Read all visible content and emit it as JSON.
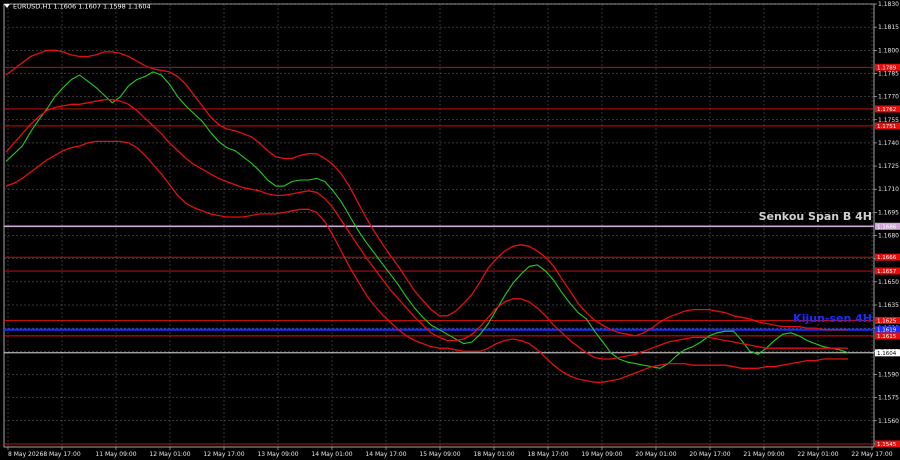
{
  "chart_data": {
    "type": "line",
    "title": "EURUSD,H1  1.1606 1.1607 1.1598 1.1604",
    "symbol_header": {
      "symbol": "EURUSD,H1",
      "open": "1.1606",
      "high": "1.1607",
      "low": "1.1598",
      "close": "1.1604"
    },
    "ylim": [
      1.1543,
      1.183
    ],
    "y_ticks": [
      "1.1830",
      "1.1815",
      "1.1800",
      "1.1785",
      "1.1770",
      "1.1755",
      "1.1740",
      "1.1725",
      "1.1710",
      "1.1695",
      "1.1680",
      "1.1665",
      "1.1650",
      "1.1635",
      "1.1620",
      "1.1605",
      "1.1590",
      "1.1575",
      "1.1560",
      "1.1545"
    ],
    "x_ticks": [
      "8 May 2026",
      "8 May 17:00",
      "11 May 09:00",
      "12 May 01:00",
      "12 May 17:00",
      "13 May 09:00",
      "14 May 01:00",
      "14 May 17:00",
      "15 May 09:00",
      "18 May 01:00",
      "18 May 17:00",
      "19 May 09:00",
      "20 May 01:00",
      "20 May 17:00",
      "21 May 09:00",
      "22 May 01:00",
      "22 May 17:00"
    ],
    "grid": true,
    "levels": [
      {
        "price": 1.1789,
        "label": "1.1789",
        "color": "#e01010"
      },
      {
        "price": 1.1762,
        "label": "1.1762",
        "color": "#e01010"
      },
      {
        "price": 1.1751,
        "label": "1.1751",
        "color": "#e01010"
      },
      {
        "price": 1.1686,
        "label": "1.1686",
        "color": "#d0a8d8"
      },
      {
        "price": 1.1666,
        "label": "1.1666",
        "color": "#e01010"
      },
      {
        "price": 1.1657,
        "label": "1.1657",
        "color": "#e01010"
      },
      {
        "price": 1.1625,
        "label": "1.1625",
        "color": "#e01010"
      },
      {
        "price": 1.1619,
        "label": "1.1619",
        "color": "#1a2cff"
      },
      {
        "price": 1.1615,
        "label": "1.1615",
        "color": "#e01010"
      },
      {
        "price": 1.1604,
        "label": "1.1604",
        "color": "#ffffff"
      },
      {
        "price": 1.1545,
        "label": "1.1545",
        "color": "#e01010"
      }
    ],
    "annotations": [
      {
        "text": "Senkou Span B 4H",
        "price": 1.169,
        "color": "#d0d0d0"
      },
      {
        "text": "Kijun-sen 4H",
        "price": 1.1624,
        "color": "#1a2cff"
      }
    ],
    "series": [
      {
        "values": [
          1.1728,
          1.1733,
          1.1738,
          1.1747,
          1.1755,
          1.1762,
          1.177,
          1.1776,
          1.1781,
          1.1784,
          1.178,
          1.1776,
          1.1771,
          1.1766,
          1.177,
          1.1777,
          1.1781,
          1.1783,
          1.1786,
          1.1784,
          1.1778,
          1.177,
          1.1764,
          1.1759,
          1.1754,
          1.1747,
          1.1741,
          1.1737,
          1.1735,
          1.1731,
          1.1727,
          1.1722,
          1.1716,
          1.1712,
          1.1712,
          1.1715,
          1.1716,
          1.1716,
          1.1717,
          1.1715,
          1.1709,
          1.1702,
          1.1693,
          1.1684,
          1.1676,
          1.1669,
          1.1662,
          1.1655,
          1.1648,
          1.164,
          1.1633,
          1.1627,
          1.1622,
          1.1619,
          1.1616,
          1.1613,
          1.161,
          1.1611,
          1.1616,
          1.1623,
          1.1632,
          1.1641,
          1.1649,
          1.1655,
          1.166,
          1.1661,
          1.1657,
          1.1651,
          1.1643,
          1.1636,
          1.163,
          1.1626,
          1.1618,
          1.1611,
          1.1604,
          1.16,
          1.1598,
          1.1597,
          1.1596,
          1.1595,
          1.1594,
          1.1597,
          1.1602,
          1.1606,
          1.1608,
          1.1611,
          1.1615,
          1.1617,
          1.1618,
          1.1618,
          1.1612,
          1.1605,
          1.1603,
          1.1607,
          1.1612,
          1.1616,
          1.1617,
          1.1615,
          1.1612,
          1.161,
          1.1608,
          1.1607,
          1.1606,
          1.1604
        ],
        "color": "#22cc22"
      },
      {
        "values": [
          1.1784,
          1.1788,
          1.1792,
          1.1796,
          1.1798,
          1.18,
          1.18,
          1.1799,
          1.1797,
          1.1796,
          1.1796,
          1.1797,
          1.1799,
          1.1799,
          1.1798,
          1.1796,
          1.1793,
          1.179,
          1.1788,
          1.1787,
          1.1786,
          1.1783,
          1.1778,
          1.1771,
          1.1764,
          1.1757,
          1.1752,
          1.1749,
          1.1748,
          1.1746,
          1.1744,
          1.174,
          1.1735,
          1.1731,
          1.173,
          1.173,
          1.1732,
          1.1733,
          1.1733,
          1.173,
          1.1726,
          1.172,
          1.1712,
          1.1702,
          1.1692,
          1.1683,
          1.1675,
          1.1667,
          1.166,
          1.1652,
          1.1644,
          1.1638,
          1.1632,
          1.1628,
          1.1628,
          1.1631,
          1.1636,
          1.1642,
          1.165,
          1.1659,
          1.1665,
          1.167,
          1.1673,
          1.1674,
          1.1673,
          1.167,
          1.1666,
          1.166,
          1.1652,
          1.1644,
          1.1636,
          1.163,
          1.1625,
          1.1622,
          1.1619,
          1.1617,
          1.1616,
          1.1615,
          1.1617,
          1.162,
          1.1624,
          1.1627,
          1.1629,
          1.1631,
          1.1632,
          1.1632,
          1.1632,
          1.1631,
          1.163,
          1.1628,
          1.1627,
          1.1626,
          1.1624,
          1.1623,
          1.1622,
          1.1621,
          1.1621,
          1.1621,
          1.162,
          1.162,
          1.1619,
          1.1619,
          1.1619,
          1.1619
        ],
        "color": "#e01010"
      },
      {
        "values": [
          1.1734,
          1.174,
          1.1746,
          1.1752,
          1.1757,
          1.1761,
          1.1763,
          1.1764,
          1.1765,
          1.1765,
          1.1766,
          1.1767,
          1.1768,
          1.1768,
          1.1767,
          1.1765,
          1.1761,
          1.1756,
          1.1751,
          1.1746,
          1.174,
          1.1735,
          1.173,
          1.1726,
          1.1723,
          1.172,
          1.1717,
          1.1715,
          1.1713,
          1.1711,
          1.171,
          1.1709,
          1.1707,
          1.1706,
          1.1706,
          1.1707,
          1.1708,
          1.1709,
          1.1708,
          1.1704,
          1.1698,
          1.169,
          1.1682,
          1.1674,
          1.1666,
          1.1659,
          1.1652,
          1.1645,
          1.1639,
          1.1633,
          1.1627,
          1.1622,
          1.1617,
          1.1614,
          1.1612,
          1.1612,
          1.1613,
          1.1616,
          1.1621,
          1.1627,
          1.1633,
          1.1637,
          1.1639,
          1.1639,
          1.1637,
          1.1633,
          1.1628,
          1.1622,
          1.1617,
          1.1612,
          1.1608,
          1.1604,
          1.1601,
          1.16,
          1.16,
          1.1601,
          1.1602,
          1.1603,
          1.1605,
          1.1607,
          1.1609,
          1.1611,
          1.1612,
          1.1613,
          1.1614,
          1.1614,
          1.1614,
          1.1613,
          1.1612,
          1.1611,
          1.161,
          1.1609,
          1.1608,
          1.1607,
          1.1607,
          1.1607,
          1.1607,
          1.1607,
          1.1607,
          1.1607,
          1.1607,
          1.1607,
          1.1607,
          1.1607
        ],
        "color": "#e01010"
      },
      {
        "values": [
          1.1712,
          1.1714,
          1.1717,
          1.1721,
          1.1725,
          1.1729,
          1.1732,
          1.1735,
          1.1737,
          1.1738,
          1.174,
          1.1741,
          1.1741,
          1.1741,
          1.1741,
          1.174,
          1.1737,
          1.1732,
          1.1726,
          1.172,
          1.1713,
          1.1706,
          1.1701,
          1.1698,
          1.1696,
          1.1694,
          1.1693,
          1.1692,
          1.1692,
          1.1692,
          1.1693,
          1.1694,
          1.1694,
          1.1694,
          1.1695,
          1.1696,
          1.1697,
          1.1697,
          1.1695,
          1.1689,
          1.168,
          1.167,
          1.166,
          1.1651,
          1.1642,
          1.1635,
          1.1629,
          1.1624,
          1.1619,
          1.1615,
          1.1612,
          1.161,
          1.1608,
          1.1607,
          1.1607,
          1.1606,
          1.1605,
          1.1605,
          1.1605,
          1.1607,
          1.161,
          1.1612,
          1.1613,
          1.1612,
          1.161,
          1.1606,
          1.1601,
          1.1596,
          1.1592,
          1.1589,
          1.1587,
          1.1586,
          1.1585,
          1.1585,
          1.1586,
          1.1587,
          1.1589,
          1.1591,
          1.1593,
          1.1595,
          1.1596,
          1.1597,
          1.1597,
          1.1597,
          1.1596,
          1.1596,
          1.1596,
          1.1596,
          1.1596,
          1.1595,
          1.1594,
          1.1594,
          1.1594,
          1.1595,
          1.1595,
          1.1596,
          1.1597,
          1.1598,
          1.1599,
          1.1599,
          1.16,
          1.16,
          1.16,
          1.16
        ],
        "color": "#e01010"
      }
    ]
  }
}
